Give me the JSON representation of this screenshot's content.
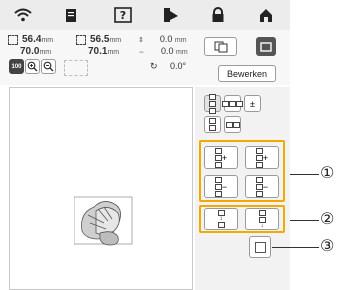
{
  "topbar": {
    "icons": [
      "wifi-icon",
      "document-icon",
      "help-icon",
      "thread-spool-icon",
      "lock-icon",
      "home-icon"
    ]
  },
  "info": {
    "size_w": "56.4",
    "size_h": "70.0",
    "size_w2": "56.5",
    "size_h2": "70.1",
    "unit": "mm",
    "offset_x": "0.0",
    "offset_y": "0.0",
    "angle": "0.0°"
  },
  "zoom": {
    "label": "100"
  },
  "edit_button": "Bewerken",
  "callouts": [
    "①",
    "②",
    "③"
  ],
  "colors": {
    "highlight": "#f2a900",
    "panel": "#f2f2f2"
  }
}
